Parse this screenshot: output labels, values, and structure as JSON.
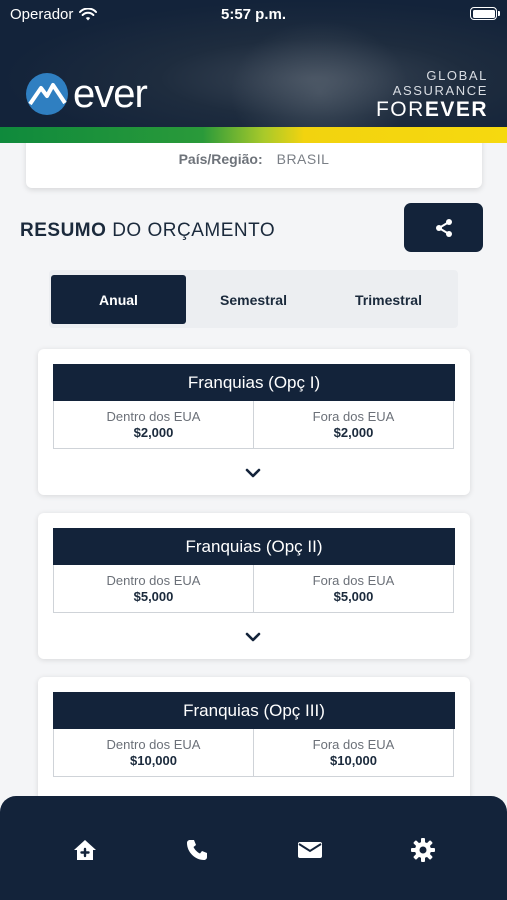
{
  "status_bar": {
    "carrier": "Operador",
    "time": "5:57 p.m."
  },
  "brand": {
    "logo_text": "ever",
    "tagline_line1": "GLOBAL",
    "tagline_line2": "ASSURANCE",
    "tagline_line3_light": "FOR",
    "tagline_line3_bold": "EVER",
    "colors": {
      "navy": "#13233a",
      "green": "#0f8a3c",
      "yellow": "#f6d90f",
      "logo_blue": "#2f7fc1"
    }
  },
  "country": {
    "label": "País/Região:",
    "value": "BRASIL"
  },
  "summary": {
    "title_bold": "RESUMO",
    "title_rest": "DO ORÇAMENTO",
    "share_icon": "share-icon"
  },
  "tabs": [
    {
      "label": "Anual",
      "active": true
    },
    {
      "label": "Semestral",
      "active": false
    },
    {
      "label": "Trimestral",
      "active": false
    }
  ],
  "options": [
    {
      "title": "Franquias (Opç I)",
      "inside_label": "Dentro dos EUA",
      "inside_value": "$2,000",
      "outside_label": "Fora dos EUA",
      "outside_value": "$2,000"
    },
    {
      "title": "Franquias (Opç II)",
      "inside_label": "Dentro dos EUA",
      "inside_value": "$5,000",
      "outside_label": "Fora dos EUA",
      "outside_value": "$5,000"
    },
    {
      "title": "Franquias (Opç III)",
      "inside_label": "Dentro dos EUA",
      "inside_value": "$10,000",
      "outside_label": "Fora dos EUA",
      "outside_value": "$10,000"
    }
  ],
  "bottom_nav": [
    "home-icon",
    "phone-icon",
    "mail-icon",
    "settings-icon"
  ]
}
